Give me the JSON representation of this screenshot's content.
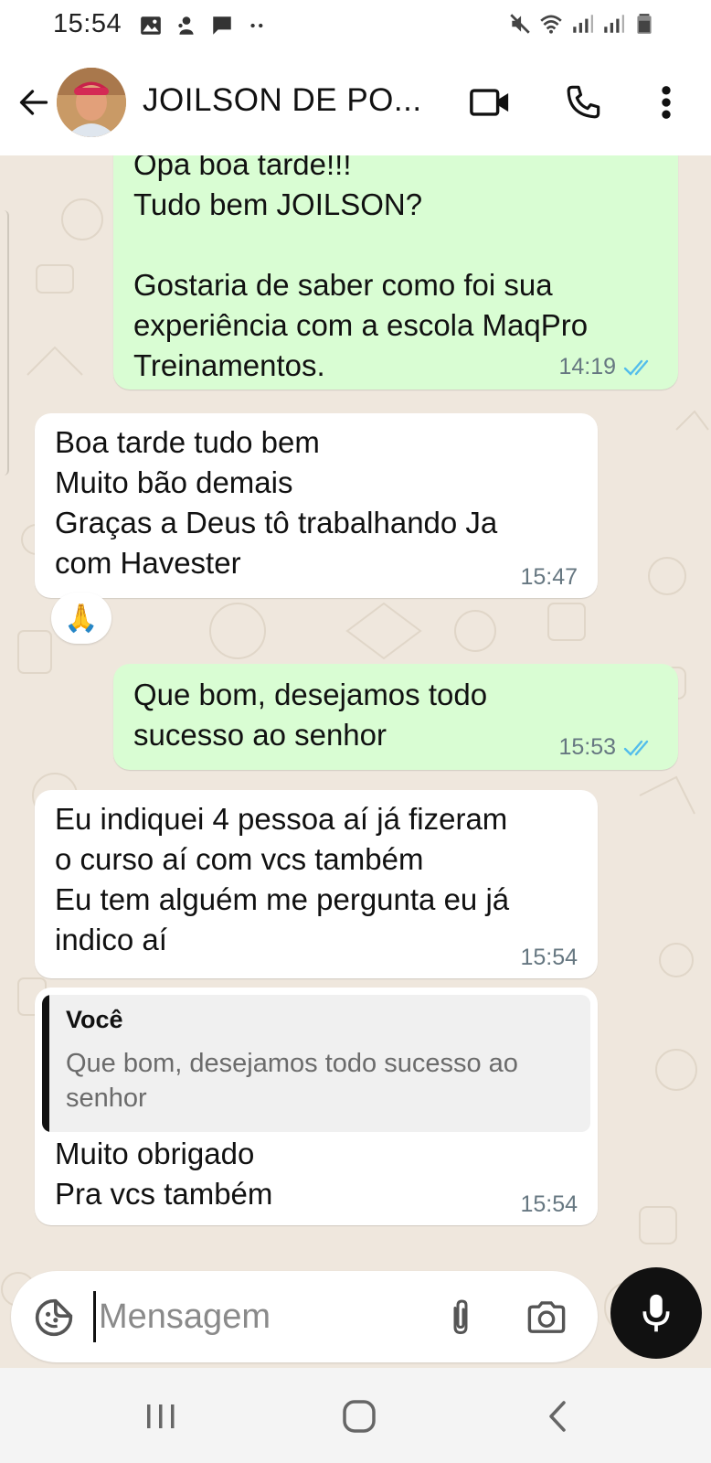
{
  "status_bar": {
    "time": "15:54",
    "left_icons": [
      "image-icon",
      "app-notification-icon",
      "chat-notification-icon",
      "more-notifications-icon"
    ],
    "right_icons": [
      "mute-icon",
      "wifi-icon",
      "signal-icon",
      "signal-icon-2",
      "battery-icon"
    ]
  },
  "header": {
    "contact_name": "JOILSON DE PO...",
    "icons": [
      "back-arrow-icon",
      "video-call-icon",
      "phone-icon",
      "more-vert-icon"
    ]
  },
  "messages": [
    {
      "direction": "outgoing",
      "text": "Opa boa tarde!!!\nTudo bem JOILSON?\n\nGostaria de saber como foi sua\nexperiência com a escola MaqPro\nTreinamentos.",
      "time": "14:19",
      "status": "read"
    },
    {
      "direction": "incoming",
      "text": "Boa tarde tudo bem\nMuito bão demais\nGraças a Deus tô  trabalhando Ja\ncom Havester",
      "time": "15:47",
      "reaction": "🙏"
    },
    {
      "direction": "outgoing",
      "text": "Que bom, desejamos todo\nsucesso ao senhor",
      "time": "15:53",
      "status": "read"
    },
    {
      "direction": "incoming",
      "text": "Eu indiquei 4 pessoa aí já fizeram\no curso aí com vcs também\nEu tem alguém me pergunta eu já\nindico aí",
      "time": "15:54"
    },
    {
      "direction": "incoming",
      "quote": {
        "author": "Você",
        "text": "Que bom, desejamos todo sucesso ao senhor"
      },
      "text": "Muito obrigado\nPra vcs também",
      "time": "15:54"
    }
  ],
  "composer": {
    "placeholder": "Mensagem",
    "value": "",
    "icons": [
      "emoji-sticker-icon",
      "attach-icon",
      "camera-icon",
      "mic-icon"
    ]
  },
  "nav": {
    "icons": [
      "recent-apps-icon",
      "home-icon",
      "back-icon"
    ]
  },
  "colors": {
    "outgoing_bubble": "#d9fdd3",
    "incoming_bubble": "#ffffff",
    "chat_background": "#efe7dd",
    "read_ticks": "#53bdeb",
    "mic_button": "#111111"
  }
}
